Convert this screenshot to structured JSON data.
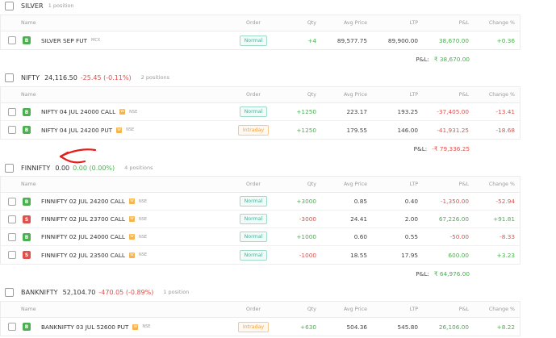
{
  "columns": {
    "instrument": "Name",
    "order": "Order",
    "qty": "Qty",
    "avg": "Avg Price",
    "ltp": "LTP",
    "pnl": "P&L",
    "chg": "Change %"
  },
  "pnl_label": "P&L:",
  "groups": [
    {
      "name": "SILVER",
      "count": "1 position",
      "rows": [
        {
          "side": "B",
          "name": "SILVER SEP FUT",
          "weekly": false,
          "exchange": "MCX",
          "order": "Normal",
          "qty": "+4",
          "avg": "89,577.75",
          "ltp": "89,900.00",
          "pnl": "38,670.00",
          "chg": "+0.36"
        }
      ],
      "total": "₹ 38,670.00"
    },
    {
      "name": "NIFTY",
      "price": "24,116.50",
      "change": "-25.45 (-0.11%)",
      "count": "2 positions",
      "rows": [
        {
          "side": "B",
          "name": "NIFTY 04 JUL 24000 CALL",
          "weekly": true,
          "exchange": "NSE",
          "order": "Normal",
          "qty": "+1250",
          "avg": "223.17",
          "ltp": "193.25",
          "pnl": "-37,405.00",
          "chg": "-13.41"
        },
        {
          "side": "B",
          "name": "NIFTY 04 JUL 24200 PUT",
          "weekly": true,
          "exchange": "NSE",
          "order": "Intraday",
          "qty": "+1250",
          "avg": "179.55",
          "ltp": "146.00",
          "pnl": "-41,931.25",
          "chg": "-18.68"
        }
      ],
      "total": "-₹ 79,336.25"
    },
    {
      "name": "FINNIFTY",
      "price": "0.00",
      "change": "0.00 (0.00%)",
      "count": "4 positions",
      "rows": [
        {
          "side": "B",
          "name": "FINNIFTY 02 JUL 24200 CALL",
          "weekly": true,
          "exchange": "NSE",
          "order": "Normal",
          "qty": "+3000",
          "avg": "0.85",
          "ltp": "0.40",
          "pnl": "-1,350.00",
          "chg": "-52.94"
        },
        {
          "side": "S",
          "name": "FINNIFTY 02 JUL 23700 CALL",
          "weekly": true,
          "exchange": "NSE",
          "order": "Normal",
          "qty": "-3000",
          "avg": "24.41",
          "ltp": "2.00",
          "pnl": "67,226.00",
          "chg": "+91.81"
        },
        {
          "side": "B",
          "name": "FINNIFTY 02 JUL 24000 CALL",
          "weekly": true,
          "exchange": "NSE",
          "order": "Normal",
          "qty": "+1000",
          "avg": "0.60",
          "ltp": "0.55",
          "pnl": "-50.00",
          "chg": "-8.33"
        },
        {
          "side": "S",
          "name": "FINNIFTY 02 JUL 23500 CALL",
          "weekly": true,
          "exchange": "NSE",
          "order": "Normal",
          "qty": "-1000",
          "avg": "18.55",
          "ltp": "17.95",
          "pnl": "600.00",
          "chg": "+3.23"
        }
      ],
      "total": "₹ 64,976.00"
    },
    {
      "name": "BANKNIFTY",
      "price": "52,104.70",
      "change": "-470.05 (-0.89%)",
      "count": "1 position",
      "rows": [
        {
          "side": "B",
          "name": "BANKNIFTY 03 JUL 52600 PUT",
          "weekly": true,
          "exchange": "NSE",
          "order": "Intraday",
          "qty": "+630",
          "avg": "504.36",
          "ltp": "545.80",
          "pnl": "26,106.00",
          "chg": "+8.22"
        }
      ]
    }
  ],
  "weekly_badge": "W",
  "colors": {
    "positive": "#4caf50",
    "negative": "#df514c",
    "annotation": "#e0201a"
  },
  "annotation": "red-arrow"
}
